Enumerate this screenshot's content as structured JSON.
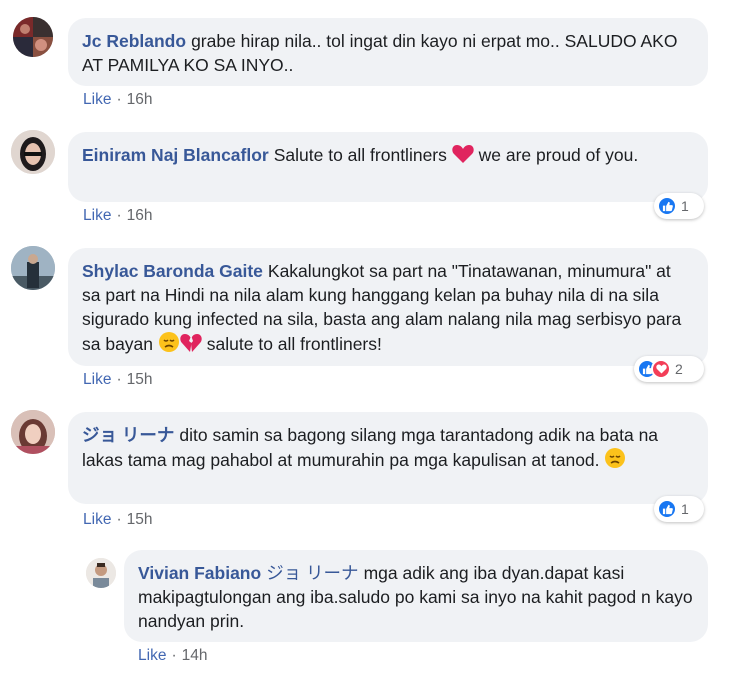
{
  "comments": [
    {
      "author": "Jc Reblando",
      "text": "grabe hirap nila.. tol ingat din kayo ni erpat mo.. SALUDO AKO AT PAMILYA KO SA INYO..",
      "like_label": "Like",
      "time": "16h",
      "reaction_count": null,
      "avatar_icon": "user-photo-avatar"
    },
    {
      "author": "Einiram Naj Blancaflor",
      "text_before_emoji": "Salute to all frontliners",
      "text_after_emoji": "we are proud of you.",
      "emoji": "red-heart-icon",
      "like_label": "Like",
      "time": "16h",
      "reaction_count": "1",
      "reactions": [
        "like-icon"
      ],
      "avatar_icon": "user-photo-avatar"
    },
    {
      "author": "Shylac Baronda Gaite",
      "text_before_emoji": "Kakalungkot sa part na \"Tinatawanan, minumura\" at sa part na Hindi na nila alam kung hanggang kelan pa buhay nila di na sila sigurado kung infected na sila, basta ang alam nalang nila mag serbisyo para sa bayan",
      "text_after_emoji": "salute to all frontliners!",
      "emoji": [
        "disappointed-face-icon",
        "broken-heart-icon"
      ],
      "like_label": "Like",
      "time": "15h",
      "reaction_count": "2",
      "reactions": [
        "like-icon",
        "love-icon"
      ],
      "avatar_icon": "user-photo-avatar"
    },
    {
      "author": "ジョ リーナ",
      "text": "dito samin sa bagong silang mga tarantadong adik na bata na lakas tama mag pahabol at mumurahin pa mga kapulisan at tanod.",
      "emoji": "disappointed-face-icon",
      "like_label": "Like",
      "time": "15h",
      "reaction_count": "1",
      "reactions": [
        "like-icon"
      ],
      "avatar_icon": "user-photo-avatar"
    },
    {
      "author": "Vivian Fabiano",
      "mention": "ジョ リーナ",
      "text": "mga adik ang iba dyan.dapat kasi makipagtulongan ang iba.saludo po kami sa inyo na kahit pagod n kayo nandyan prin.",
      "like_label": "Like",
      "time": "14h",
      "reaction_count": null,
      "avatar_icon": "user-photo-avatar"
    }
  ],
  "colors": {
    "bubble": "#f0f2f5",
    "author": "#385898",
    "like": "#4267b2",
    "meta": "#65676b",
    "like_reaction": "#1877f2",
    "love_reaction": "#f33e58"
  }
}
